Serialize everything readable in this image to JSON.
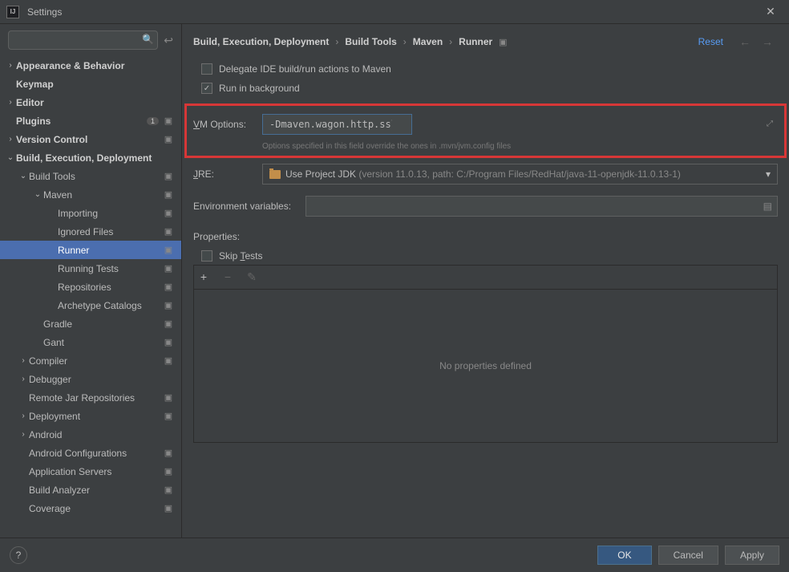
{
  "window": {
    "title": "Settings"
  },
  "sidebar": {
    "search_placeholder": "",
    "items": [
      {
        "label": "Appearance & Behavior",
        "level": 0,
        "bold": true,
        "arrow": "›",
        "gear": false
      },
      {
        "label": "Keymap",
        "level": 0,
        "bold": true,
        "arrow": "",
        "gear": false
      },
      {
        "label": "Editor",
        "level": 0,
        "bold": true,
        "arrow": "›",
        "gear": false
      },
      {
        "label": "Plugins",
        "level": 0,
        "bold": true,
        "arrow": "",
        "gear": true,
        "badge": "1"
      },
      {
        "label": "Version Control",
        "level": 0,
        "bold": true,
        "arrow": "›",
        "gear": true
      },
      {
        "label": "Build, Execution, Deployment",
        "level": 0,
        "bold": true,
        "arrow": "⌄",
        "gear": false
      },
      {
        "label": "Build Tools",
        "level": 1,
        "bold": false,
        "arrow": "⌄",
        "gear": true
      },
      {
        "label": "Maven",
        "level": 2,
        "bold": false,
        "arrow": "⌄",
        "gear": true
      },
      {
        "label": "Importing",
        "level": 3,
        "bold": false,
        "arrow": "",
        "gear": true
      },
      {
        "label": "Ignored Files",
        "level": 3,
        "bold": false,
        "arrow": "",
        "gear": true
      },
      {
        "label": "Runner",
        "level": 3,
        "bold": false,
        "arrow": "",
        "gear": true,
        "selected": true
      },
      {
        "label": "Running Tests",
        "level": 3,
        "bold": false,
        "arrow": "",
        "gear": true
      },
      {
        "label": "Repositories",
        "level": 3,
        "bold": false,
        "arrow": "",
        "gear": true
      },
      {
        "label": "Archetype Catalogs",
        "level": 3,
        "bold": false,
        "arrow": "",
        "gear": true
      },
      {
        "label": "Gradle",
        "level": 2,
        "bold": false,
        "arrow": "",
        "gear": true
      },
      {
        "label": "Gant",
        "level": 2,
        "bold": false,
        "arrow": "",
        "gear": true
      },
      {
        "label": "Compiler",
        "level": 1,
        "bold": false,
        "arrow": "›",
        "gear": true
      },
      {
        "label": "Debugger",
        "level": 1,
        "bold": false,
        "arrow": "›",
        "gear": false
      },
      {
        "label": "Remote Jar Repositories",
        "level": 1,
        "bold": false,
        "arrow": "",
        "gear": true
      },
      {
        "label": "Deployment",
        "level": 1,
        "bold": false,
        "arrow": "›",
        "gear": true
      },
      {
        "label": "Android",
        "level": 1,
        "bold": false,
        "arrow": "›",
        "gear": false
      },
      {
        "label": "Android Configurations",
        "level": 1,
        "bold": false,
        "arrow": "",
        "gear": true
      },
      {
        "label": "Application Servers",
        "level": 1,
        "bold": false,
        "arrow": "",
        "gear": true
      },
      {
        "label": "Build Analyzer",
        "level": 1,
        "bold": false,
        "arrow": "",
        "gear": true
      },
      {
        "label": "Coverage",
        "level": 1,
        "bold": false,
        "arrow": "",
        "gear": true
      }
    ]
  },
  "breadcrumb": {
    "parts": [
      "Build, Execution, Deployment",
      "Build Tools",
      "Maven",
      "Runner"
    ]
  },
  "header": {
    "reset": "Reset"
  },
  "form": {
    "delegate_label": "Delegate IDE build/run actions to Maven",
    "run_bg_label": "Run in background",
    "vm_label": "VM Options:",
    "vm_value": "-Dmaven.wagon.http.ssl.insecure=true -Dmaven.wagon.http.ssl.allowall=true",
    "vm_hint": "Options specified in this field override the ones in .mvn/jvm.config files",
    "jre_label": "JRE:",
    "jre_text_a": "Use Project JDK ",
    "jre_text_b": "(version 11.0.13, path: C:/Program Files/RedHat/java-11-openjdk-11.0.13-1)",
    "env_label": "Environment variables:",
    "props_label": "Properties:",
    "skip_label": "Skip Tests",
    "empty": "No properties defined"
  },
  "footer": {
    "ok": "OK",
    "cancel": "Cancel",
    "apply": "Apply"
  }
}
